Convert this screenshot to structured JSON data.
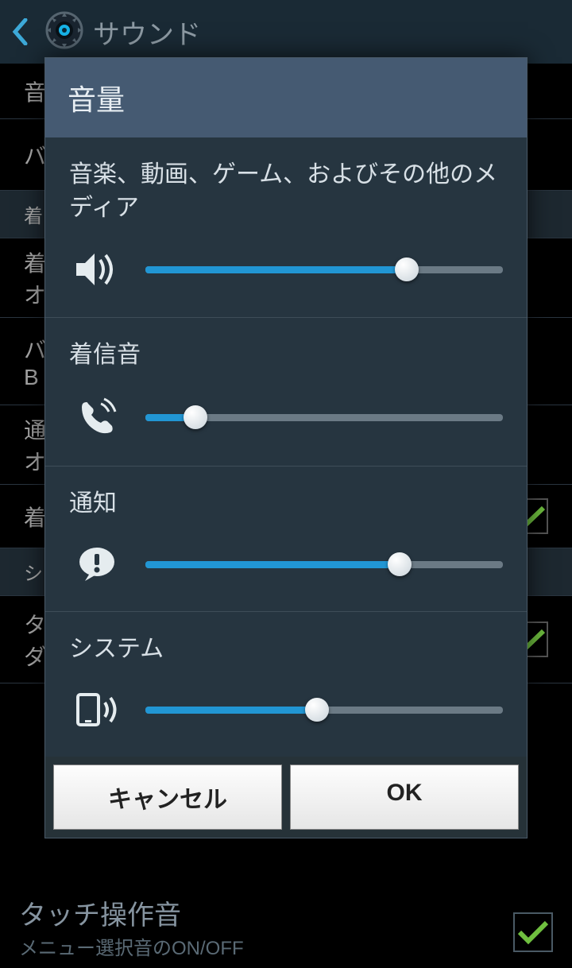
{
  "header": {
    "title": "サウンド"
  },
  "dialog": {
    "title": "音量",
    "sections": [
      {
        "label": "音楽、動画、ゲーム、およびその他のメディア",
        "value": 73
      },
      {
        "label": "着信音",
        "value": 14
      },
      {
        "label": "通知",
        "value": 71
      },
      {
        "label": "システム",
        "value": 48
      }
    ],
    "buttons": {
      "cancel": "キャンセル",
      "ok": "OK"
    }
  },
  "bg": {
    "item1": "タッチ操作音",
    "item2": "メニュー選択音のON/OFF"
  },
  "colors": {
    "accent": "#2196d4"
  }
}
